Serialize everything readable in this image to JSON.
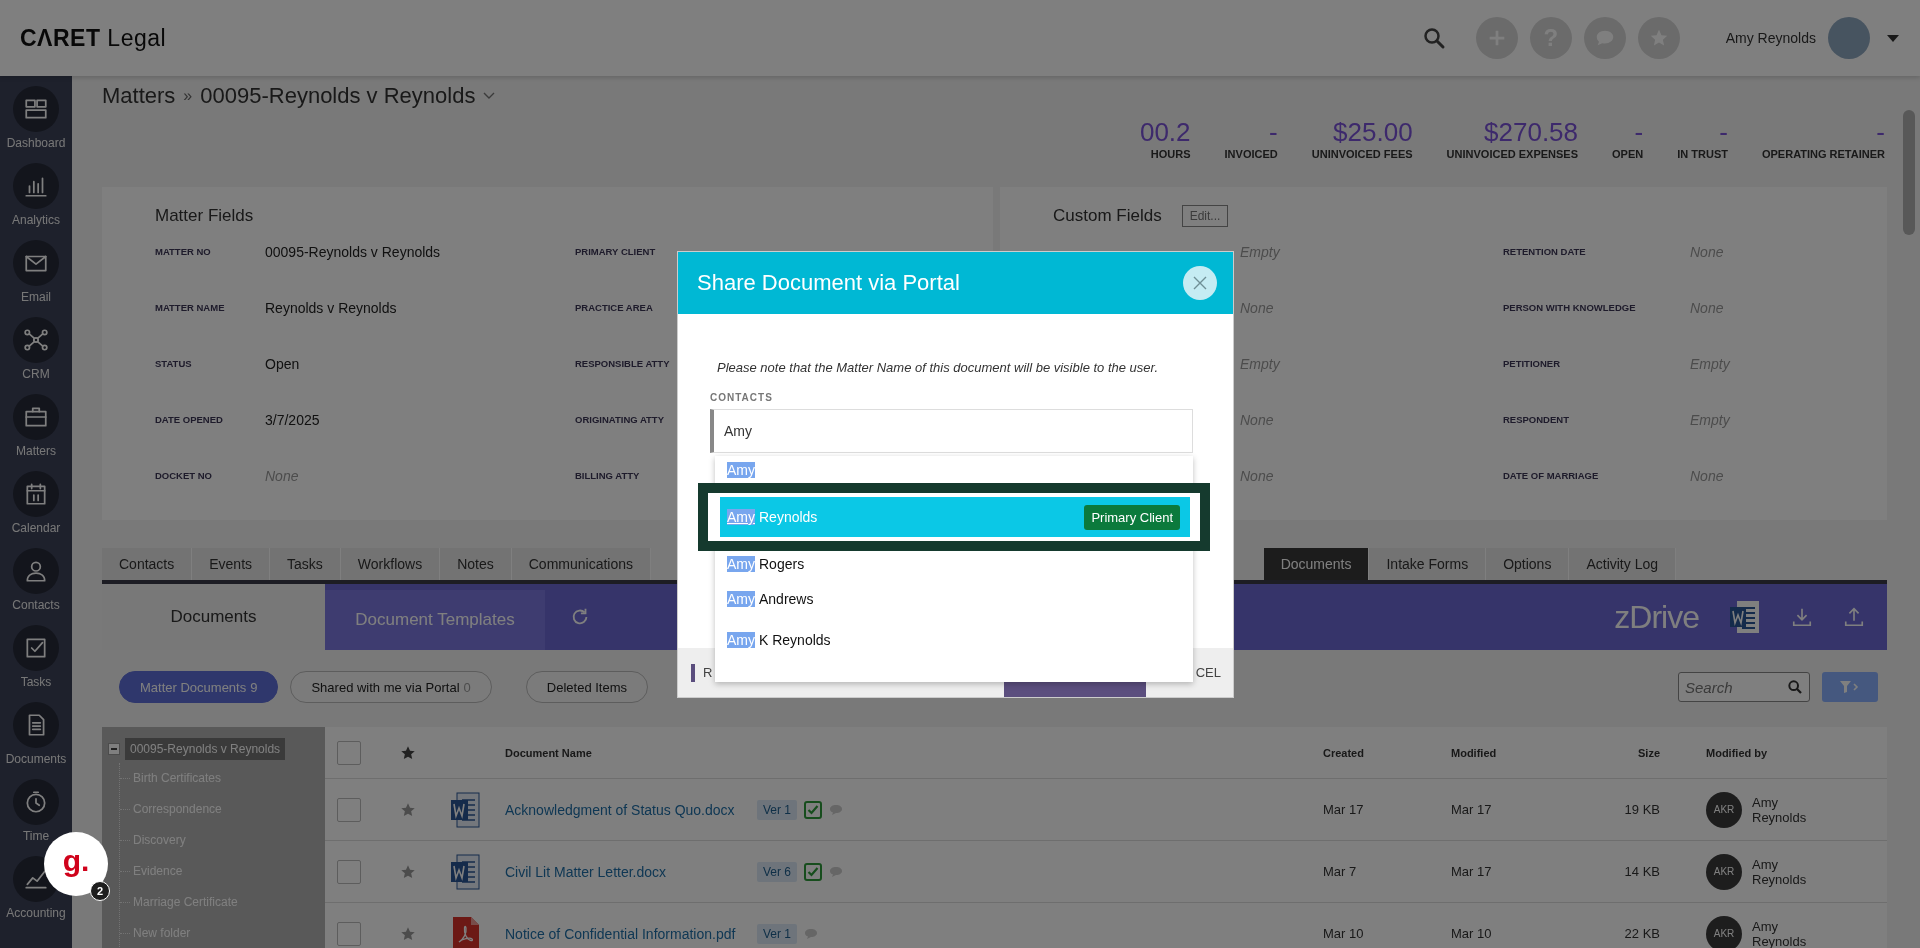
{
  "header": {
    "logo": "**CɅRET** Legal",
    "help": "?",
    "user": "Amy Reynolds"
  },
  "sidebar": {
    "items": [
      {
        "label": "Dashboard"
      },
      {
        "label": "Analytics"
      },
      {
        "label": "Email"
      },
      {
        "label": "CRM"
      },
      {
        "label": "Matters"
      },
      {
        "label": "Calendar"
      },
      {
        "label": "Contacts"
      },
      {
        "label": "Tasks"
      },
      {
        "label": "Documents"
      },
      {
        "label": "Time"
      },
      {
        "label": "Accounting"
      }
    ]
  },
  "breadcrumb": {
    "root": "Matters",
    "separator": "»",
    "current": "00095-Reynolds v Reynolds"
  },
  "stats": [
    {
      "value": "00.2",
      "label": "HOURS"
    },
    {
      "value": "-",
      "label": "INVOICED"
    },
    {
      "value": "$25.00",
      "label": "UNINVOICED FEES"
    },
    {
      "value": "$270.58",
      "label": "UNINVOICED EXPENSES"
    },
    {
      "value": "-",
      "label": "OPEN"
    },
    {
      "value": "-",
      "label": "IN TRUST"
    },
    {
      "value": "-",
      "label": "OPERATING RETAINER"
    }
  ],
  "matter_fields": {
    "title": "Matter Fields",
    "rows": [
      {
        "label": "MATTER NO",
        "value": "00095-Reynolds v Reynolds",
        "empty": false,
        "label_2": "PRIMARY CLIENT"
      },
      {
        "label": "MATTER NAME",
        "value": "Reynolds v Reynolds",
        "empty": false,
        "label_2": "PRACTICE AREA"
      },
      {
        "label": "STATUS",
        "value": "Open",
        "empty": false,
        "label_2": "RESPONSIBLE ATTY"
      },
      {
        "label": "DATE OPENED",
        "value": "3/7/2025",
        "empty": false,
        "label_2": "ORIGINATING ATTY"
      },
      {
        "label": "DOCKET NO",
        "value": "None",
        "empty": true,
        "label_2": "BILLING ATTY"
      }
    ]
  },
  "custom_fields": {
    "title": "Custom Fields",
    "edit": "Edit...",
    "rows": [
      {
        "value": "Empty",
        "empty": true,
        "label_2": "RETENTION DATE",
        "value_2": "None",
        "empty_2": true
      },
      {
        "value": "None",
        "empty": true,
        "label_2": "PERSON WITH KNOWLEDGE",
        "value_2": "None",
        "empty_2": true
      },
      {
        "value": "Empty",
        "empty": true,
        "label_2": "PETITIONER",
        "value_2": "Empty",
        "empty_2": true
      },
      {
        "value": "None",
        "empty": true,
        "label_2": "RESPONDENT",
        "value_2": "Empty",
        "empty_2": true
      },
      {
        "value": "None",
        "empty": true,
        "label_2": "DATE OF MARRIAGE",
        "value_2": "None",
        "empty_2": true
      }
    ]
  },
  "tabs_left": [
    {
      "label": "Contacts",
      "selected": false
    },
    {
      "label": "Events",
      "selected": false
    },
    {
      "label": "Tasks",
      "selected": false
    },
    {
      "label": "Workflows",
      "selected": false
    },
    {
      "label": "Notes",
      "selected": false
    },
    {
      "label": "Communications",
      "selected": false
    }
  ],
  "tabs_right": [
    {
      "label": "Documents",
      "selected": true
    },
    {
      "label": "Intake Forms",
      "selected": false
    },
    {
      "label": "Options",
      "selected": false
    },
    {
      "label": "Activity Log",
      "selected": false
    }
  ],
  "doc_tabs": [
    {
      "label": "Documents",
      "selected": true
    },
    {
      "label": "Document Templates",
      "selected": false
    }
  ],
  "zdrive": "zDrive",
  "filters": [
    {
      "label": "Matter Documents",
      "count": "9",
      "selected": true
    },
    {
      "label": "Shared with me via Portal",
      "count": "0",
      "selected": false
    },
    {
      "label": "Deleted Items",
      "selected": false
    }
  ],
  "search": {
    "placeholder": "Search"
  },
  "tree": {
    "label": "00095-Reynolds v Reynolds",
    "expanded": true,
    "children": [
      {
        "label": "Birth Certificates"
      },
      {
        "label": "Correspondence"
      },
      {
        "label": "Discovery"
      },
      {
        "label": "Evidence"
      },
      {
        "label": "Marriage Certificate"
      },
      {
        "label": "New folder"
      }
    ]
  },
  "table": {
    "all_checked": false,
    "columns": [
      "Document Name",
      "Created",
      "Modified",
      "Size",
      "Modified by"
    ],
    "rows": [
      {
        "checked": false,
        "kind": "word",
        "name": "Acknowledgment of Status Quo.docx",
        "version": "Ver 1",
        "shared": true,
        "created": "Mar 17",
        "modified": "Mar 17",
        "size": "19 KB",
        "initials": "AKR",
        "modified_by": "Amy Reynolds"
      },
      {
        "checked": false,
        "kind": "word",
        "name": "Civil Lit Matter Letter.docx",
        "version": "Ver 6",
        "shared": true,
        "created": "Mar 7",
        "modified": "Mar 17",
        "size": "14 KB",
        "initials": "AKR",
        "modified_by": "Amy Reynolds"
      },
      {
        "checked": false,
        "kind": "pdf",
        "name": "Notice of Confidential Information.pdf",
        "version": "Ver 1",
        "shared": false,
        "created": "Mar 10",
        "modified": "Mar 10",
        "size": "22 KB",
        "initials": "AKR",
        "modified_by": "Amy Reynolds"
      }
    ]
  },
  "widget": {
    "logo": "g.",
    "count": "2"
  },
  "modal": {
    "title": "Share Document via Portal",
    "note": "Please note that the Matter Name of this document will be visible to the user.",
    "contacts_label": "CONTACTS",
    "query": "Amy",
    "options": [
      {
        "match": "Amy",
        "selected": false
      },
      {
        "match": "Amy",
        "rest": "Reynolds",
        "selected": true,
        "badge": "Primary Client"
      },
      {
        "match": "Amy",
        "rest": "Rogers",
        "selected": false
      },
      {
        "match": "Amy",
        "rest": "Andrews",
        "selected": false
      },
      {
        "match": "Amy",
        "rest": "K Reynolds",
        "selected": false
      }
    ],
    "footer_left": "R",
    "footer_right": "CEL"
  }
}
